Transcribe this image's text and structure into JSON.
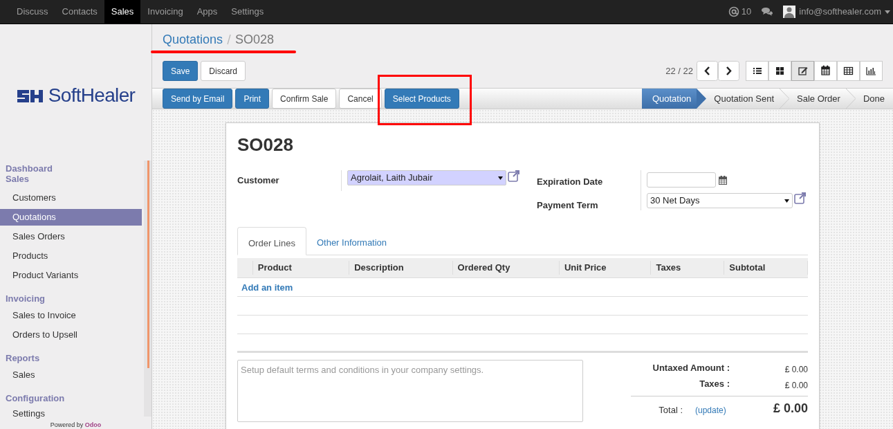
{
  "top_nav": {
    "apps": [
      {
        "label": "Discuss",
        "selected": false
      },
      {
        "label": "Contacts",
        "selected": false
      },
      {
        "label": "Sales",
        "selected": true
      },
      {
        "label": "Invoicing",
        "selected": false
      },
      {
        "label": "Apps",
        "selected": false
      },
      {
        "label": "Settings",
        "selected": false
      }
    ],
    "mentions": "10",
    "user": "info@softhealer.com"
  },
  "sidebar": {
    "brand": "SoftHealer",
    "sections": [
      {
        "title": "Dashboard"
      },
      {
        "title": "Sales",
        "items": [
          {
            "label": "Customers",
            "selected": false
          },
          {
            "label": "Quotations",
            "selected": true
          },
          {
            "label": "Sales Orders",
            "selected": false
          },
          {
            "label": "Products",
            "selected": false
          },
          {
            "label": "Product Variants",
            "selected": false
          }
        ]
      },
      {
        "title": "Invoicing",
        "items": [
          {
            "label": "Sales to Invoice",
            "selected": false
          },
          {
            "label": "Orders to Upsell",
            "selected": false
          }
        ]
      },
      {
        "title": "Reports",
        "items": [
          {
            "label": "Sales",
            "selected": false
          }
        ]
      },
      {
        "title": "Configuration",
        "items": [
          {
            "label": "Settings",
            "selected": false
          }
        ]
      }
    ],
    "footer_prefix": "Powered by",
    "footer_brand": "Odoo"
  },
  "breadcrumb": [
    "Quotations",
    "SO028"
  ],
  "edit_buttons": [
    {
      "label": "Save",
      "primary": true
    },
    {
      "label": "Discard",
      "primary": false
    }
  ],
  "pager": "22 / 22",
  "views": [
    {
      "kind": "list",
      "selected": false
    },
    {
      "kind": "kanban",
      "selected": false
    },
    {
      "kind": "form",
      "selected": true
    },
    {
      "kind": "calendar",
      "selected": false
    },
    {
      "kind": "pivot",
      "selected": false
    },
    {
      "kind": "graph",
      "selected": false
    }
  ],
  "actions": [
    {
      "label": "Send by Email",
      "primary": true
    },
    {
      "label": "Print",
      "primary": true
    },
    {
      "label": "Confirm Sale",
      "primary": false
    },
    {
      "label": "Cancel",
      "primary": false
    },
    {
      "label": "Select Products",
      "primary": true,
      "highlighted": true
    }
  ],
  "stages": [
    {
      "label": "Quotation",
      "selected": true
    },
    {
      "label": "Quotation Sent",
      "selected": false
    },
    {
      "label": "Sale Order",
      "selected": false
    },
    {
      "label": "Done",
      "selected": false
    }
  ],
  "form": {
    "title": "SO028",
    "customer": {
      "label": "Customer",
      "value": "Agrolait, Laith Jubair"
    },
    "expiration": {
      "label": "Expiration Date"
    },
    "payment_term": {
      "label": "Payment Term",
      "value": "30 Net Days"
    },
    "tabs": [
      {
        "label": "Order Lines",
        "selected": true
      },
      {
        "label": "Other Information",
        "selected": false
      }
    ],
    "columns": [
      "Product",
      "Description",
      "Ordered Qty",
      "Unit Price",
      "Taxes",
      "Subtotal"
    ],
    "add_item": "Add an item",
    "notes_placeholder": "Setup default terms and conditions in your company settings.",
    "totals": [
      {
        "label": "Untaxed Amount :",
        "value": "£ 0.00"
      },
      {
        "label": "Taxes :",
        "value": "£ 0.00"
      }
    ],
    "total": {
      "label": "Total :",
      "link": "(update)",
      "value": "£ 0.00"
    }
  }
}
